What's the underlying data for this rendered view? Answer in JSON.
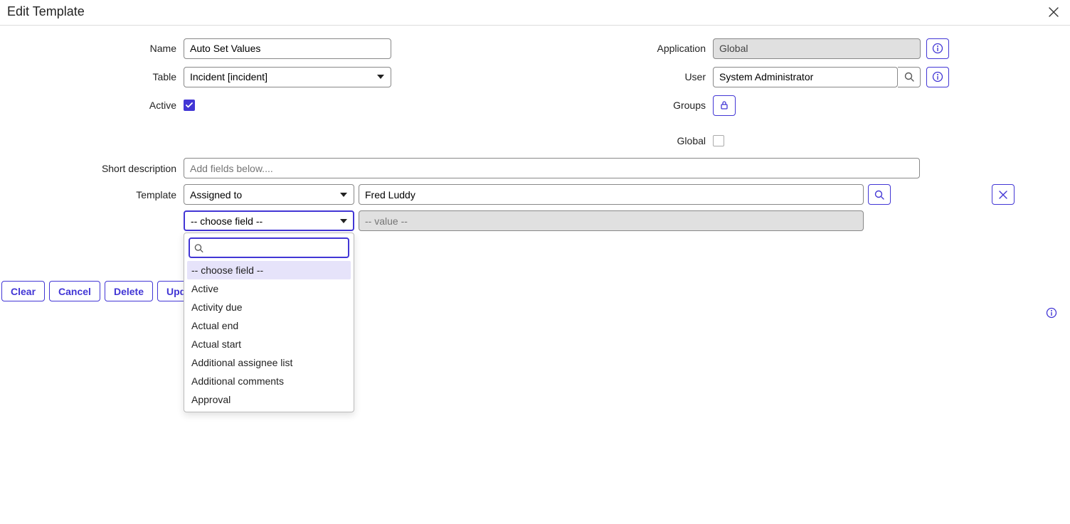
{
  "header": {
    "title": "Edit Template"
  },
  "fields": {
    "name_label": "Name",
    "name_value": "Auto Set Values",
    "table_label": "Table",
    "table_value": "Incident [incident]",
    "active_label": "Active",
    "active_checked": true,
    "application_label": "Application",
    "application_value": "Global",
    "user_label": "User",
    "user_value": "System Administrator",
    "groups_label": "Groups",
    "global_label": "Global",
    "global_checked": false,
    "short_desc_label": "Short description",
    "short_desc_placeholder": "Add fields below....",
    "template_label": "Template"
  },
  "template_rows": [
    {
      "field": "Assigned to",
      "value": "Fred Luddy",
      "has_lookup": true
    },
    {
      "field": "-- choose field --",
      "value_placeholder": "-- value --",
      "readonly_value": true
    }
  ],
  "dropdown": {
    "options": [
      "-- choose field --",
      "Active",
      "Activity due",
      "Actual end",
      "Actual start",
      "Additional assignee list",
      "Additional comments",
      "Approval"
    ],
    "highlighted_index": 0
  },
  "buttons": {
    "clear": "Clear",
    "cancel": "Cancel",
    "delete": "Delete",
    "update": "Update"
  }
}
